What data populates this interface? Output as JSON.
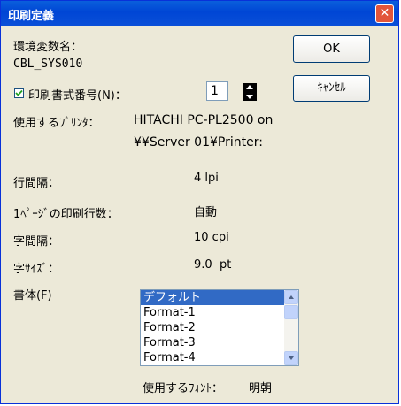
{
  "window": {
    "title": "印刷定義",
    "close": "✕"
  },
  "env": {
    "label": "環境変数名：",
    "value": "CBL_SYS010"
  },
  "buttons": {
    "ok": "OK",
    "cancel": "ｷｬﾝｾﾙ"
  },
  "print_format": {
    "checked": true,
    "label": "印刷書式番号(N)：",
    "value": "1"
  },
  "printer": {
    "label": "使用するﾌﾟﾘﾝﾀ：",
    "name": "HITACHI PC-PL2500 on",
    "path": "¥¥Server 01¥Printer:"
  },
  "line_spacing": {
    "label": "行間隔：",
    "value": "4 lpi"
  },
  "lines_per_page": {
    "label": "1ﾍﾟｰｼﾞの印刷行数：",
    "value": "自動"
  },
  "char_spacing": {
    "label": "字間隔：",
    "value": "10 cpi"
  },
  "char_size": {
    "label": "字ｻｲｽﾞ：",
    "value": "9.0  pt"
  },
  "typeface": {
    "label": "書体(F)",
    "items": [
      "デフォルト",
      "Format-1",
      "Format-2",
      "Format-3",
      "Format-4"
    ],
    "selected_index": 0,
    "font_label": "使用するﾌｫﾝﾄ：",
    "font_value": "明朝"
  }
}
